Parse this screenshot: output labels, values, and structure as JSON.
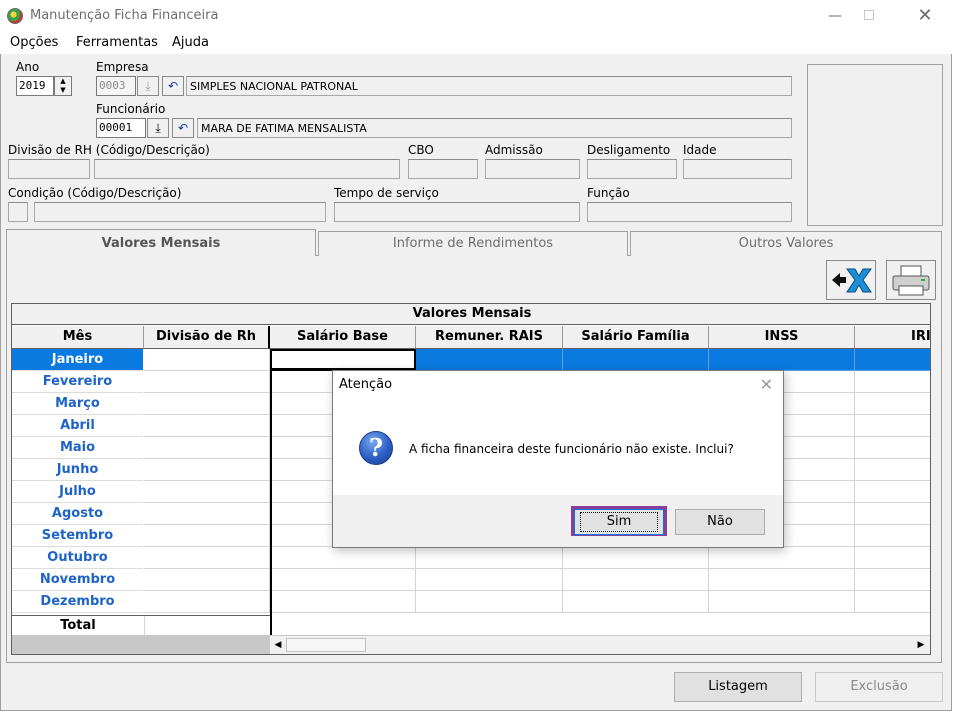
{
  "window": {
    "title": "Manutenção Ficha Financeira",
    "min_icon": "minimize-icon",
    "max_icon": "maximize-icon",
    "close_icon": "close-icon"
  },
  "menu": [
    "Opções",
    "Ferramentas",
    "Ajuda"
  ],
  "form": {
    "ano_label": "Ano",
    "ano_value": "2019",
    "empresa_label": "Empresa",
    "empresa_code": "0003",
    "empresa_name": "SIMPLES NACIONAL PATRONAL",
    "funcionario_label": "Funcionário",
    "funcionario_code": "00001",
    "funcionario_name": "MARA DE FATIMA MENSALISTA",
    "divisao_label": "Divisão de RH (Código/Descrição)",
    "cbo_label": "CBO",
    "admissao_label": "Admissão",
    "desligamento_label": "Desligamento",
    "idade_label": "Idade",
    "condicao_label": "Condição (Código/Descrição)",
    "tempo_label": "Tempo de serviço",
    "funcao_label": "Função"
  },
  "tabs": [
    "Valores Mensais",
    "Informe de Rendimentos",
    "Outros Valores"
  ],
  "grid": {
    "caption": "Valores Mensais",
    "columns": [
      "Mês",
      "Divisão de Rh",
      "Salário Base",
      "Remuner. RAIS",
      "Salário Família",
      "INSS",
      "IRI"
    ],
    "months": [
      "Janeiro",
      "Fevereiro",
      "Março",
      "Abril",
      "Maio",
      "Junho",
      "Julho",
      "Agosto",
      "Setembro",
      "Outubro",
      "Novembro",
      "Dezembro"
    ],
    "total_label": "Total"
  },
  "buttons": {
    "listagem": "Listagem",
    "exclusao": "Exclusão"
  },
  "dialog": {
    "title": "Atenção",
    "message": "A ficha financeira deste funcionário não existe. Inclui?",
    "yes": "Sim",
    "no": "Não"
  },
  "colors": {
    "selected_row": "#0a7ae0",
    "month_text": "#1f63c7",
    "focus_highlight": "#8b3d9b"
  }
}
